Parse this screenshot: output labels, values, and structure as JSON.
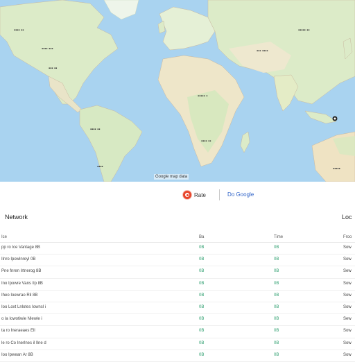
{
  "map": {
    "attribution": "Google map data",
    "colors": {
      "water": "#a9d3f0",
      "land": "#e3efd2",
      "land_dry": "#f2ecd6",
      "border": "#c9b9a0"
    },
    "labels": [
      "Russia",
      "Canada",
      "United States",
      "Brazil",
      "Africa",
      "China",
      "India",
      "Australia",
      "Europe"
    ],
    "marker_icon": "location-pin-icon"
  },
  "brand": {
    "left_icon": "brand-logo-icon",
    "left_label": "Rate",
    "right_label": "Do Google"
  },
  "panel": {
    "title": "Network",
    "title_right": "Loc",
    "columns": [
      "Ice",
      "Ba",
      "Time",
      "Froo"
    ]
  },
  "table": {
    "rows": [
      {
        "name": "pp ro Ice Vantage 8B",
        "v1": "0B",
        "v2": "0B",
        "v3": "Sow"
      },
      {
        "name": "Ilnro Ipowlnreyl 0B",
        "v1": "0B",
        "v2": "0B",
        "v3": "Sow"
      },
      {
        "name": "Pne fnren Irtnerog 8B",
        "v1": "0B",
        "v2": "0B",
        "v3": "Sew"
      },
      {
        "name": "Ino Ipowre Vans Ilp 8B",
        "v1": "0B",
        "v2": "0B",
        "v3": "Sow"
      },
      {
        "name": "Iheo Ioewrao Ril 8B",
        "v1": "0B",
        "v2": "0B",
        "v3": "Sow"
      },
      {
        "name": "Ioo Loxt Lnlotes Iownsl i",
        "v1": "0B",
        "v2": "0B",
        "v3": "Sow"
      },
      {
        "name": "o la Iowotiwie Nlewle i",
        "v1": "0B",
        "v2": "0B",
        "v3": "Sew"
      },
      {
        "name": "ta ro Ineraeaes Ell",
        "v1": "0B",
        "v2": "0B",
        "v3": "Sow"
      },
      {
        "name": "le ro Co Inerlnes il Ilne d",
        "v1": "0B",
        "v2": "0B",
        "v3": "Sow"
      },
      {
        "name": "Ioo Ipwean Ar 8B",
        "v1": "0B",
        "v2": "0B",
        "v3": "Sow"
      }
    ]
  }
}
